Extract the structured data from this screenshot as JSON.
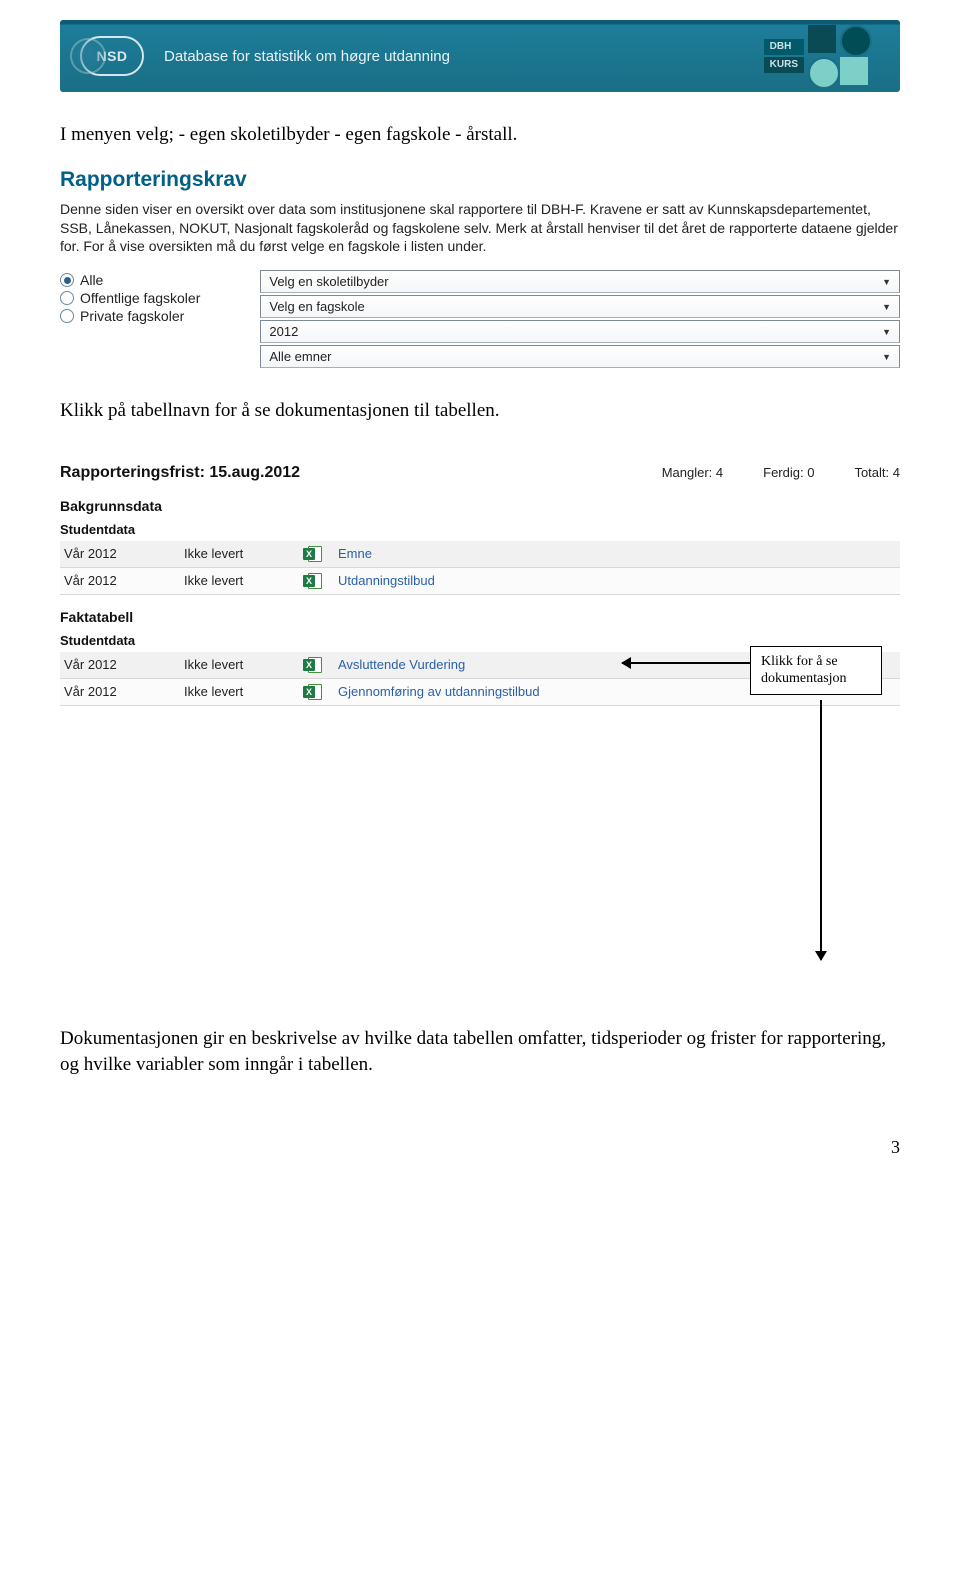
{
  "header": {
    "logo_text": "NSD",
    "title": "Database for statistikk om høgre utdanning",
    "badge1": "DBH",
    "badge2": "KURS"
  },
  "intro_line": "I menyen velg; - egen skoletilbyder - egen fagskole - årstall.",
  "rk": {
    "heading": "Rapporteringskrav",
    "para": "Denne siden viser en oversikt over data som institusjonene skal rapportere til DBH-F. Kravene er satt av Kunnskapsdepartementet, SSB, Lånekassen, NOKUT, Nasjonalt fagskoleråd og fagskolene selv. Merk at årstall henviser til det året de rapporterte dataene gjelder for. For å vise oversikten må du først velge en fagskole i listen under."
  },
  "radios": [
    {
      "label": "Alle",
      "selected": true
    },
    {
      "label": "Offentlige fagskoler",
      "selected": false
    },
    {
      "label": "Private fagskoler",
      "selected": false
    }
  ],
  "selects": [
    "Velg en skoletilbyder",
    "Velg en fagskole",
    "2012",
    "Alle emner"
  ],
  "click_instruction": "Klikk på tabellnavn for å se dokumentasjonen til tabellen.",
  "status": {
    "title": "Rapporteringsfrist: 15.aug.2012",
    "mangler_label": "Mangler:",
    "mangler_value": "4",
    "ferdig_label": "Ferdig:",
    "ferdig_value": "0",
    "totalt_label": "Totalt:",
    "totalt_value": "4"
  },
  "sections": [
    {
      "category": "Bakgrunnsdata",
      "sub": "Studentdata",
      "rows": [
        {
          "sem": "Vår 2012",
          "status": "Ikke levert",
          "name": "Emne"
        },
        {
          "sem": "Vår 2012",
          "status": "Ikke levert",
          "name": "Utdanningstilbud"
        }
      ]
    },
    {
      "category": "Faktatabell",
      "sub": "Studentdata",
      "rows": [
        {
          "sem": "Vår 2012",
          "status": "Ikke levert",
          "name": "Avsluttende Vurdering"
        },
        {
          "sem": "Vår 2012",
          "status": "Ikke levert",
          "name": "Gjennomføring av utdanningstilbud"
        }
      ]
    }
  ],
  "callout": {
    "line1": "Klikk for å se",
    "line2": "dokumentasjon"
  },
  "closing_para": "Dokumentasjonen gir en beskrivelse av hvilke data tabellen omfatter, tidsperioder og frister for rapportering, og hvilke variabler som inngår i tabellen.",
  "page_number": "3"
}
